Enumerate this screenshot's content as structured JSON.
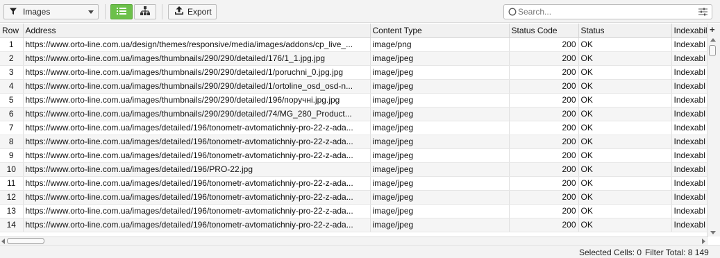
{
  "toolbar": {
    "filter_label": "Images",
    "export_label": "Export",
    "search_placeholder": "Search..."
  },
  "table": {
    "columns": [
      "Row",
      "Address",
      "Content Type",
      "Status Code",
      "Status",
      "Indexabil"
    ],
    "rows": [
      {
        "row": "1",
        "address": "https://www.orto-line.com.ua/design/themes/responsive/media/images/addons/cp_live_...",
        "content_type": "image/png",
        "status_code": "200",
        "status": "OK",
        "indexability": "Indexabl"
      },
      {
        "row": "2",
        "address": "https://www.orto-line.com.ua/images/thumbnails/290/290/detailed/176/1_1.jpg.jpg",
        "content_type": "image/jpeg",
        "status_code": "200",
        "status": "OK",
        "indexability": "Indexabl"
      },
      {
        "row": "3",
        "address": "https://www.orto-line.com.ua/images/thumbnails/290/290/detailed/1/poruchni_0.jpg.jpg",
        "content_type": "image/jpeg",
        "status_code": "200",
        "status": "OK",
        "indexability": "Indexabl"
      },
      {
        "row": "4",
        "address": "https://www.orto-line.com.ua/images/thumbnails/290/290/detailed/1/ortoline_osd_osd-n...",
        "content_type": "image/jpeg",
        "status_code": "200",
        "status": "OK",
        "indexability": "Indexabl"
      },
      {
        "row": "5",
        "address": "https://www.orto-line.com.ua/images/thumbnails/290/290/detailed/196/поручні.jpg.jpg",
        "content_type": "image/jpeg",
        "status_code": "200",
        "status": "OK",
        "indexability": "Indexabl"
      },
      {
        "row": "6",
        "address": "https://www.orto-line.com.ua/images/thumbnails/290/290/detailed/74/MG_280_Product...",
        "content_type": "image/jpeg",
        "status_code": "200",
        "status": "OK",
        "indexability": "Indexabl"
      },
      {
        "row": "7",
        "address": "https://www.orto-line.com.ua/images/detailed/196/tonometr-avtomatichniy-pro-22-z-ada...",
        "content_type": "image/jpeg",
        "status_code": "200",
        "status": "OK",
        "indexability": "Indexabl"
      },
      {
        "row": "8",
        "address": "https://www.orto-line.com.ua/images/detailed/196/tonometr-avtomatichniy-pro-22-z-ada...",
        "content_type": "image/jpeg",
        "status_code": "200",
        "status": "OK",
        "indexability": "Indexabl"
      },
      {
        "row": "9",
        "address": "https://www.orto-line.com.ua/images/detailed/196/tonometr-avtomatichniy-pro-22-z-ada...",
        "content_type": "image/jpeg",
        "status_code": "200",
        "status": "OK",
        "indexability": "Indexabl"
      },
      {
        "row": "10",
        "address": "https://www.orto-line.com.ua/images/detailed/196/PRO-22.jpg",
        "content_type": "image/jpeg",
        "status_code": "200",
        "status": "OK",
        "indexability": "Indexabl"
      },
      {
        "row": "11",
        "address": "https://www.orto-line.com.ua/images/detailed/196/tonometr-avtomatichniy-pro-22-z-ada...",
        "content_type": "image/jpeg",
        "status_code": "200",
        "status": "OK",
        "indexability": "Indexabl"
      },
      {
        "row": "12",
        "address": "https://www.orto-line.com.ua/images/detailed/196/tonometr-avtomatichniy-pro-22-z-ada...",
        "content_type": "image/jpeg",
        "status_code": "200",
        "status": "OK",
        "indexability": "Indexabl"
      },
      {
        "row": "13",
        "address": "https://www.orto-line.com.ua/images/detailed/196/tonometr-avtomatichniy-pro-22-z-ada...",
        "content_type": "image/jpeg",
        "status_code": "200",
        "status": "OK",
        "indexability": "Indexabl"
      },
      {
        "row": "14",
        "address": "https://www.orto-line.com.ua/images/detailed/196/tonometr-avtomatichniy-pro-22-z-ada...",
        "content_type": "image/jpeg",
        "status_code": "200",
        "status": "OK",
        "indexability": "Indexabl"
      }
    ]
  },
  "statusbar": {
    "selected_cells": "Selected Cells:  0",
    "filter_total": "Filter Total:  8 149"
  },
  "colors": {
    "accent": "#6cc04a",
    "toolbar_bg": "#f3f3f3",
    "row_alt": "#f5f5f5"
  },
  "icons": [
    "filter-icon",
    "list-view-icon",
    "tree-view-icon",
    "export-icon",
    "search-icon",
    "settings-sliders-icon",
    "add-column-icon"
  ]
}
